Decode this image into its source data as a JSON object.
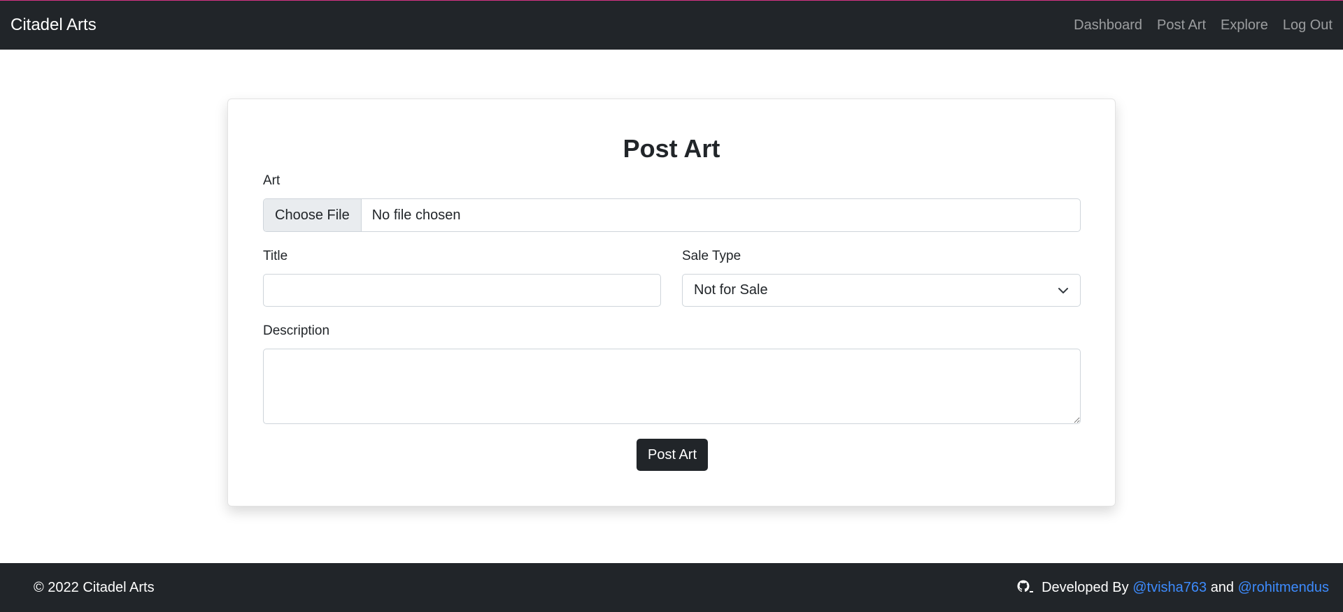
{
  "navbar": {
    "brand": "Citadel Arts",
    "links": [
      "Dashboard",
      "Post Art",
      "Explore",
      "Log Out"
    ]
  },
  "form": {
    "title": "Post Art",
    "art_label": "Art",
    "file_button": "Choose File",
    "file_status": "No file chosen",
    "title_label": "Title",
    "title_value": "",
    "sale_type_label": "Sale Type",
    "sale_type_value": "Not for Sale",
    "description_label": "Description",
    "description_value": "",
    "submit_label": "Post Art"
  },
  "footer": {
    "copyright": "© 2022 Citadel Arts",
    "developed_by": "Developed By",
    "dev1": "@tvisha763",
    "and": "and",
    "dev2": "@rohitmendus"
  },
  "colors": {
    "navbar_bg": "#212529",
    "link_blue": "#3d8bfd"
  }
}
